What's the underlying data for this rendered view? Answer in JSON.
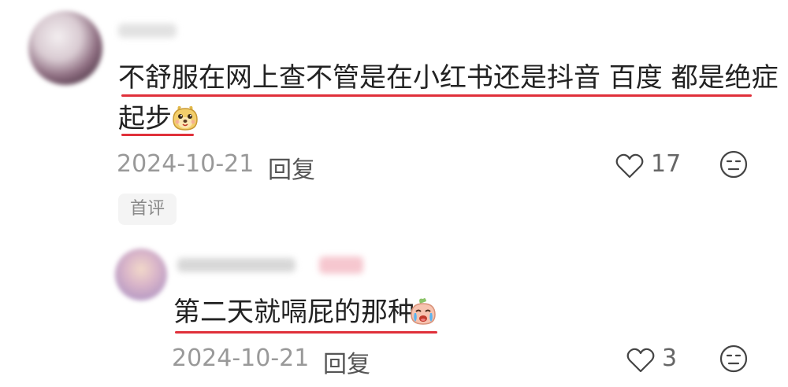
{
  "comment": {
    "line1": "不舒服在网上查不管是在小红书还是抖音 百度 都是绝症",
    "line2": "起步",
    "emoji": "smirking-dog-face",
    "date": "2024-10-21",
    "reply_label": "回复",
    "likes": "17",
    "badge": "首评"
  },
  "reply": {
    "text": "第二天就嗝屁的那种",
    "emoji": "crying-face",
    "date": "2024-10-21",
    "reply_label": "回复",
    "likes": "3"
  },
  "colors": {
    "underline": "#e0303a",
    "meta_text": "#999999"
  }
}
